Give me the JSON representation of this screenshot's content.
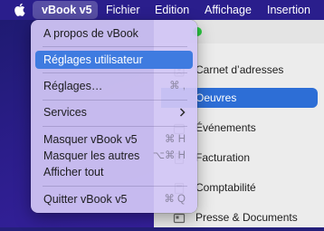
{
  "menubar": {
    "apple_icon": "apple-icon",
    "app_name": "vBook v5",
    "items": [
      "Fichier",
      "Edition",
      "Affichage",
      "Insertion"
    ]
  },
  "app_menu": {
    "about": "A propos de vBook",
    "user_settings": "Réglages utilisateur",
    "settings": "Réglages…",
    "settings_shortcut": "⌘ ,",
    "services": "Services",
    "services_icon": "chevron-right-icon",
    "hide": "Masquer vBook v5",
    "hide_shortcut": "⌘ H",
    "hide_others": "Masquer les autres",
    "hide_others_shortcut": "⌥⌘ H",
    "show_all": "Afficher tout",
    "quit": "Quitter vBook v5",
    "quit_shortcut": "⌘ Q"
  },
  "sidebar": {
    "items": [
      {
        "label": "Carnet d’adresses",
        "icon": "address-book-icon"
      },
      {
        "label": "Oeuvres",
        "icon": "works-icon"
      },
      {
        "label": "Événements",
        "icon": "calendar-icon"
      },
      {
        "label": "Facturation",
        "icon": "invoice-icon"
      },
      {
        "label": "Comptabilité",
        "icon": "accounting-icon"
      },
      {
        "label": "Presse & Documents",
        "icon": "press-icon"
      }
    ],
    "selected_index": 1
  },
  "colors": {
    "menubar": "#2a1e8c",
    "highlight": "#3f7be0",
    "selected_sidebar": "#2d6ed6",
    "window_green": "#2ac840"
  }
}
